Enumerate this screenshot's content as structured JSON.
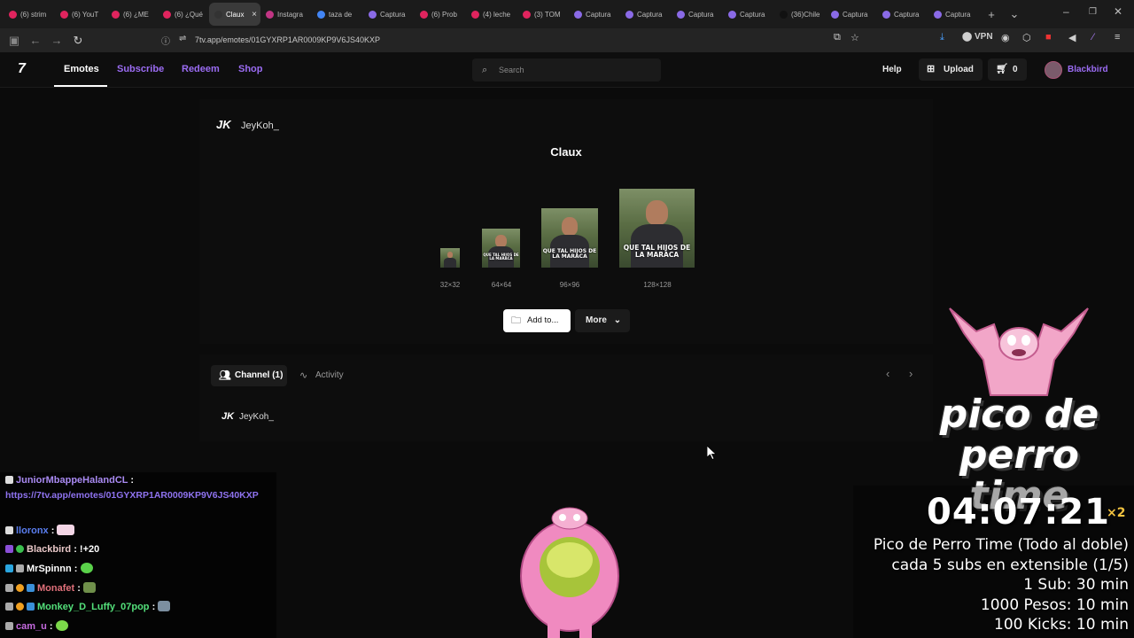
{
  "browser": {
    "tabs": [
      {
        "label": "(6) strim",
        "color": "#e0245e"
      },
      {
        "label": "(6) YouT",
        "color": "#e0245e"
      },
      {
        "label": "(6) ¿ME",
        "color": "#e0245e"
      },
      {
        "label": "(6) ¿Qué",
        "color": "#e0245e"
      },
      {
        "label": "Claux",
        "color": "#333333",
        "active": true
      },
      {
        "label": "Instagra",
        "color": "#c13584"
      },
      {
        "label": "taza de",
        "color": "#4285f4"
      },
      {
        "label": "Captura",
        "color": "#8a6ae6"
      },
      {
        "label": "(6) Prob",
        "color": "#e0245e"
      },
      {
        "label": "(4) leche",
        "color": "#e0245e"
      },
      {
        "label": "(3) TOM",
        "color": "#e0245e"
      },
      {
        "label": "Captura",
        "color": "#8a6ae6"
      },
      {
        "label": "Captura",
        "color": "#8a6ae6"
      },
      {
        "label": "Captura",
        "color": "#8a6ae6"
      },
      {
        "label": "Captura",
        "color": "#8a6ae6"
      },
      {
        "label": "(36)Chile",
        "color": "#111111"
      },
      {
        "label": "Captura",
        "color": "#8a6ae6"
      },
      {
        "label": "Captura",
        "color": "#8a6ae6"
      },
      {
        "label": "Captura",
        "color": "#8a6ae6"
      }
    ],
    "url": "7tv.app/emotes/01GYXRP1AR0009KP9V6JS40KXP",
    "vpn_label": "VPN"
  },
  "site": {
    "logo": "7",
    "nav": [
      "Emotes",
      "Subscribe",
      "Redeem",
      "Shop"
    ],
    "search_placeholder": "Search",
    "help": "Help",
    "upload": "Upload",
    "cart_count": "0",
    "user": "Blackbird"
  },
  "emote": {
    "owner_badge": "JK",
    "owner": "JeyKoh_",
    "name": "Claux",
    "caption": "QUE TAL HIJOS DE LA MARACA",
    "sizes": [
      "32×32",
      "64×64",
      "96×96",
      "128×128"
    ],
    "add_button": "Add to...",
    "more_button": "More"
  },
  "channels": {
    "tab_channel": "Channel (1)",
    "tab_activity": "Activity",
    "user_badge": "JK",
    "user": "JeyKoh_"
  },
  "chat": {
    "messages": [
      {
        "user": "JuniorMbappeHalandCL",
        "color": "#a98af2",
        "text": "",
        "link": "https://7tv.app/emotes/01GYXRP1AR0009KP9V6JS40KXP"
      },
      {
        "user": "lloronx",
        "color": "#5a7ef0",
        "text": ""
      },
      {
        "user": "Blackbird",
        "color": "#e9c8c8",
        "text": "!+20"
      },
      {
        "user": "MrSpinnn",
        "color": "#ffffff",
        "text": ""
      },
      {
        "user": "Monafet",
        "color": "#e0707a",
        "text": ""
      },
      {
        "user": "Monkey_D_Luffy_07pop",
        "color": "#53e07a",
        "text": ""
      },
      {
        "user": "cam_u",
        "color": "#c56adf",
        "text": ""
      }
    ]
  },
  "overlay": {
    "logo_line1": "pico de perro",
    "logo_line2": "time",
    "timer": "04:07:21",
    "multiplier": "×2",
    "info_lines": [
      "Pico de Perro Time (Todo al doble)",
      "cada 5 subs en extensible (1/5)",
      "1 Sub: 30 min",
      "1000 Pesos: 10 min",
      "100 Kicks: 10 min"
    ]
  }
}
